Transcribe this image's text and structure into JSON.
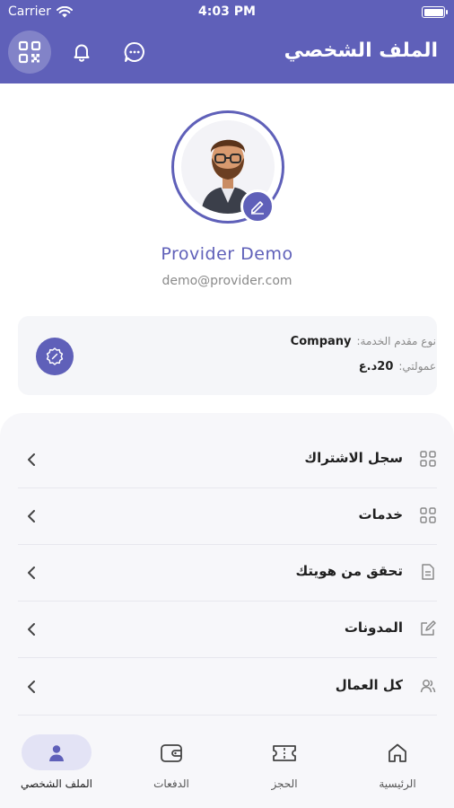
{
  "status_bar": {
    "carrier": "Carrier",
    "time": "4:03 PM"
  },
  "header": {
    "title": "الملف الشخصي"
  },
  "profile": {
    "name": "Provider Demo",
    "email": "demo@provider.com"
  },
  "info": {
    "type_label": "نوع مقدم الخدمة:",
    "type_value": "Company",
    "commission_label": "عمولتي:",
    "commission_value": "20د.ع"
  },
  "menu": [
    {
      "label": "سجل الاشتراك",
      "icon": "grid-icon"
    },
    {
      "label": "خدمات",
      "icon": "grid-icon"
    },
    {
      "label": "تحقق من هويتك",
      "icon": "document-icon"
    },
    {
      "label": "المدونات",
      "icon": "edit-note-icon"
    },
    {
      "label": "كل العمال",
      "icon": "users-icon"
    }
  ],
  "bottom_nav": [
    {
      "label": "الملف الشخصي",
      "icon": "person-icon",
      "active": true
    },
    {
      "label": "الدفعات",
      "icon": "wallet-icon",
      "active": false
    },
    {
      "label": "الحجز",
      "icon": "ticket-icon",
      "active": false
    },
    {
      "label": "الرئيسية",
      "icon": "home-icon",
      "active": false
    }
  ],
  "colors": {
    "primary": "#5f60b9",
    "sheet": "#f7f7fa",
    "card": "#f5f6f9"
  }
}
